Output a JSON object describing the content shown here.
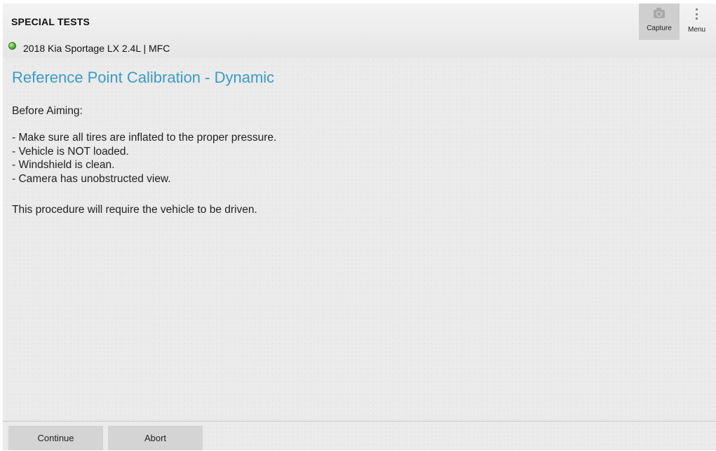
{
  "header": {
    "section_title": "SPECIAL TESTS",
    "vehicle": "2018 Kia Sportage LX 2.4L | MFC",
    "status_color": "#4caf2c",
    "tools": {
      "capture_label": "Capture",
      "capture_icon": "camera-icon",
      "menu_label": "Menu",
      "menu_icon": "vertical-dots-icon"
    }
  },
  "main": {
    "title": "Reference Point Calibration - Dynamic",
    "title_color": "#3a9bc7",
    "intro": "Before Aiming:",
    "bullets": [
      "- Make sure all tires are inflated to the proper pressure.",
      "- Vehicle is NOT loaded.",
      "- Windshield is clean.",
      "- Camera has unobstructed view."
    ],
    "note": "This procedure will require the vehicle to be driven."
  },
  "footer": {
    "continue_label": "Continue",
    "abort_label": "Abort"
  }
}
